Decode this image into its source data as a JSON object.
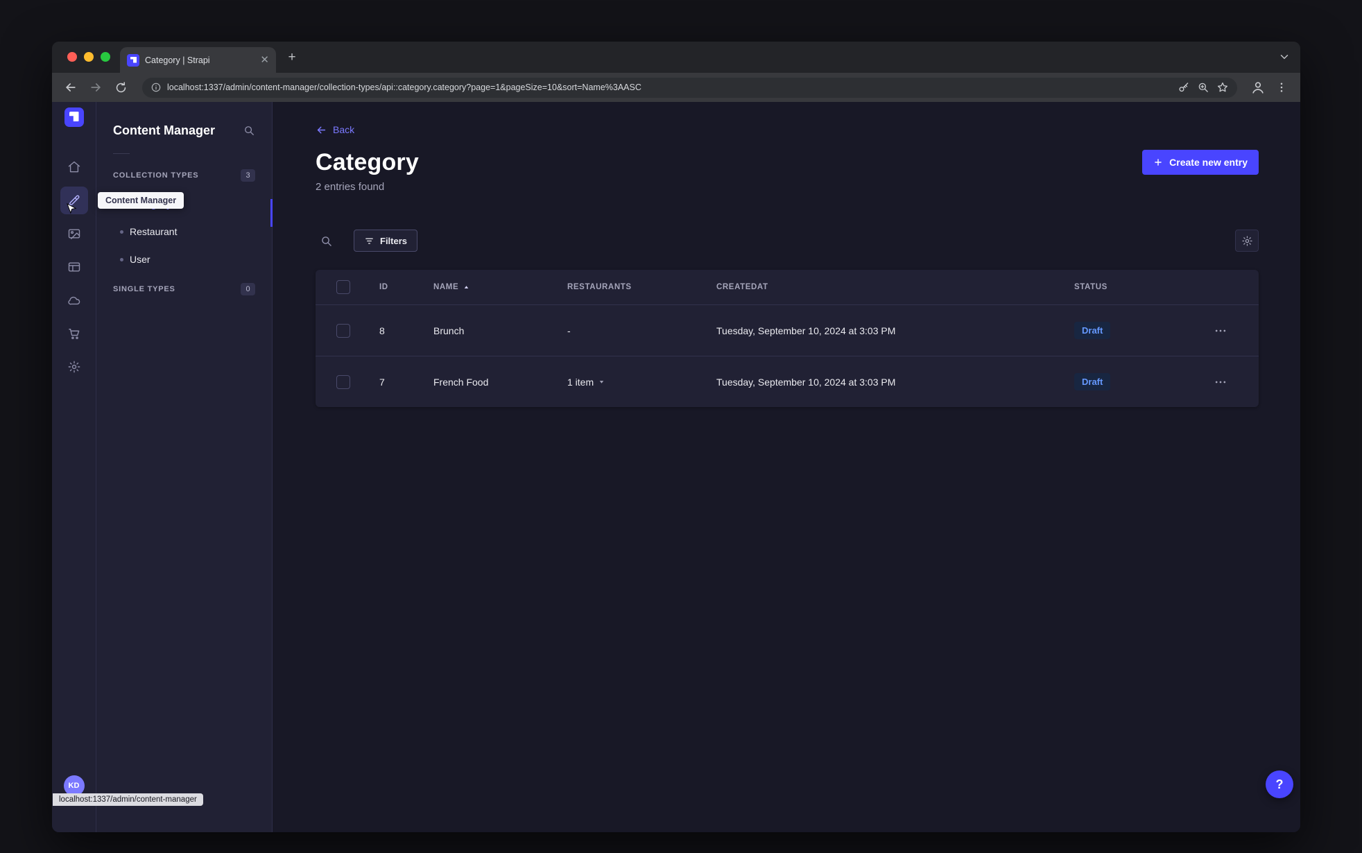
{
  "browser": {
    "tab_title": "Category | Strapi",
    "url": "localhost:1337/admin/content-manager/collection-types/api::category.category?page=1&pageSize=10&sort=Name%3AASC",
    "status_bubble": "localhost:1337/admin/content-manager"
  },
  "rail": {
    "tooltip": "Content Manager",
    "avatar_initials": "KD",
    "icons": [
      "home-icon",
      "content-manager-icon",
      "media-library-icon",
      "layout-icon",
      "cloud-icon",
      "marketplace-icon",
      "settings-icon"
    ]
  },
  "subnav": {
    "title": "Content Manager",
    "collection_types_label": "COLLECTION TYPES",
    "collection_types_badge": "3",
    "single_types_label": "SINGLE TYPES",
    "single_types_badge": "0",
    "items": [
      {
        "label": "Category",
        "active": true
      },
      {
        "label": "Restaurant",
        "active": false
      },
      {
        "label": "User",
        "active": false
      }
    ]
  },
  "main": {
    "back_label": "Back",
    "title": "Category",
    "subtitle": "2 entries found",
    "create_button_label": "Create new entry",
    "filters_label": "Filters",
    "help_label": "?",
    "table": {
      "headers": {
        "id": "ID",
        "name": "NAME",
        "restaurants": "RESTAURANTS",
        "createdat": "CREATEDAT",
        "status": "STATUS"
      },
      "rows": [
        {
          "id": "8",
          "name": "Brunch",
          "restaurants": "-",
          "created_at": "Tuesday, September 10, 2024 at 3:03 PM",
          "status": "Draft"
        },
        {
          "id": "7",
          "name": "French Food",
          "restaurants": "1 item",
          "created_at": "Tuesday, September 10, 2024 at 3:03 PM",
          "status": "Draft"
        }
      ]
    }
  },
  "colors": {
    "accent": "#4945ff",
    "accent_light": "#7b79ff",
    "draft_text": "#6699ff"
  }
}
